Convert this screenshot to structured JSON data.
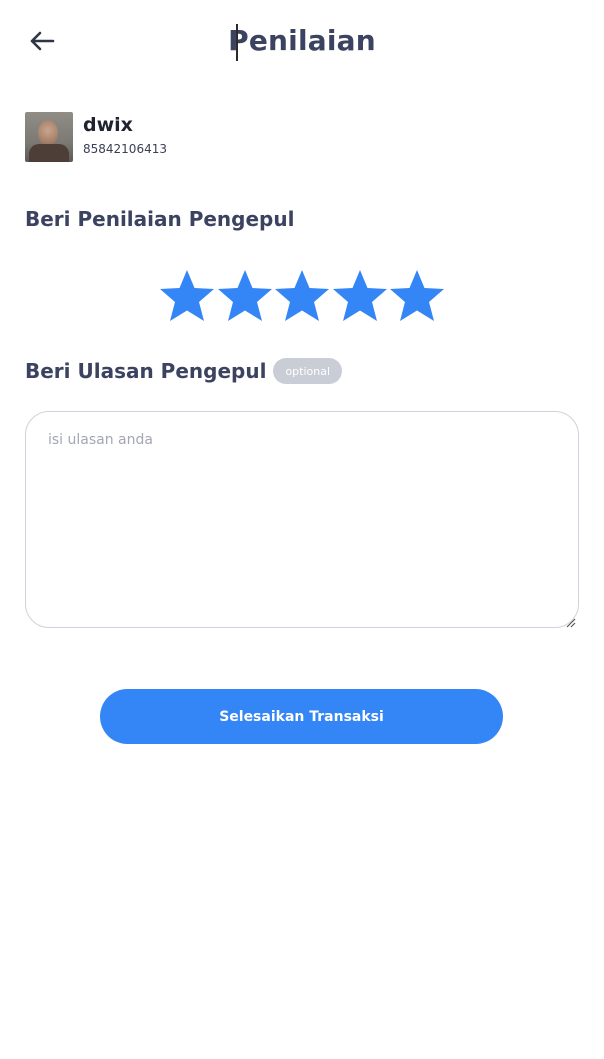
{
  "header": {
    "title": "Penilaian",
    "back_icon": "arrow-left-icon"
  },
  "user": {
    "name": "dwix",
    "phone": "85842106413"
  },
  "rating": {
    "heading": "Beri Penilaian Pengepul",
    "value": 5,
    "max": 5,
    "star_color": "#3485f6"
  },
  "review": {
    "heading": "Beri Ulasan Pengepul",
    "optional_label": "optional",
    "placeholder": "isi ulasan anda",
    "value": ""
  },
  "submit": {
    "label": "Selesaikan Transaksi",
    "color": "#3485f6"
  }
}
